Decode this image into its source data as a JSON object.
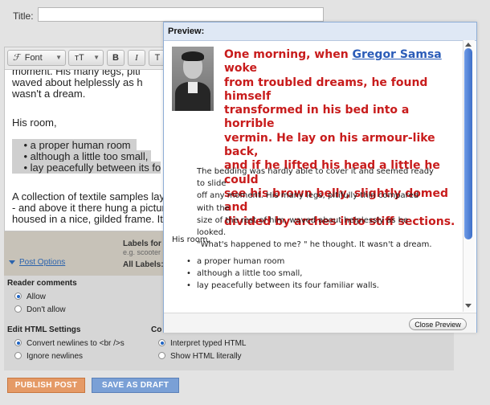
{
  "title_field": {
    "label": "Title:",
    "value": ""
  },
  "toolbar": {
    "font_label": "Font",
    "size_label": "тT",
    "bold_label": "B",
    "italic_label": "I",
    "textcolor_label": "T"
  },
  "editor": {
    "lines_top": [
      "moment. His many legs, piti",
      "waved about helplessly as h",
      "wasn't a dream."
    ],
    "room_heading": "His room,",
    "list": [
      "a proper human room",
      "although a little too small,",
      "lay peacefully between its fo"
    ],
    "lines_bottom": [
      "A collection of textile samples lay",
      "- and above it there hung a pictur",
      "housed in a nice, gilded frame. It"
    ]
  },
  "labels_area": {
    "labels_for": "Labels for t",
    "example": "e.g. scooter",
    "all_labels": "All Labels:"
  },
  "post_options": "Post Options",
  "reader_comments": {
    "heading": "Reader comments",
    "options": [
      "Allow",
      "Don't allow"
    ],
    "selected": "Allow"
  },
  "edit_html": {
    "heading": "Edit HTML Settings",
    "options": [
      "Convert newlines to <br />s",
      "Ignore newlines"
    ],
    "selected": "Convert newlines to <br />s"
  },
  "compose": {
    "heading": "Co",
    "options": [
      "Interpret typed HTML",
      "Show HTML literally"
    ],
    "selected": "Interpret typed HTML"
  },
  "buttons": {
    "publish": "PUBLISH POST",
    "draft": "SAVE AS DRAFT"
  },
  "preview": {
    "title": "Preview:",
    "lead_lines": [
      "One morning, when ",
      "Gregor Samsa",
      " woke",
      "from troubled dreams, he found himself",
      "transformed in his bed into a horrible",
      "vermin. He lay on his armour-like back,",
      "and if he lifted his head a little he could",
      "see his brown belly, slightly domed and",
      "divided by arches into stiff sections."
    ],
    "quote_lines": [
      "The bedding was hardly able to cover it and seemed ready to slide",
      "off any moment. His many legs, pitifully thin compared with the",
      "size of the rest of him, waved about helplessly as he looked.",
      "\"What's happened to me? \" he thought. It wasn't a dream."
    ],
    "room_heading": "His room,",
    "list": [
      "a proper human room",
      "although a little too small,",
      "lay peacefully between its four familiar walls."
    ],
    "close_button": "Close Preview"
  },
  "colors": {
    "lead_text": "#c81c1c",
    "link": "#2b5cb8",
    "publish": "#e59a66",
    "draft": "#7aa0d6"
  }
}
